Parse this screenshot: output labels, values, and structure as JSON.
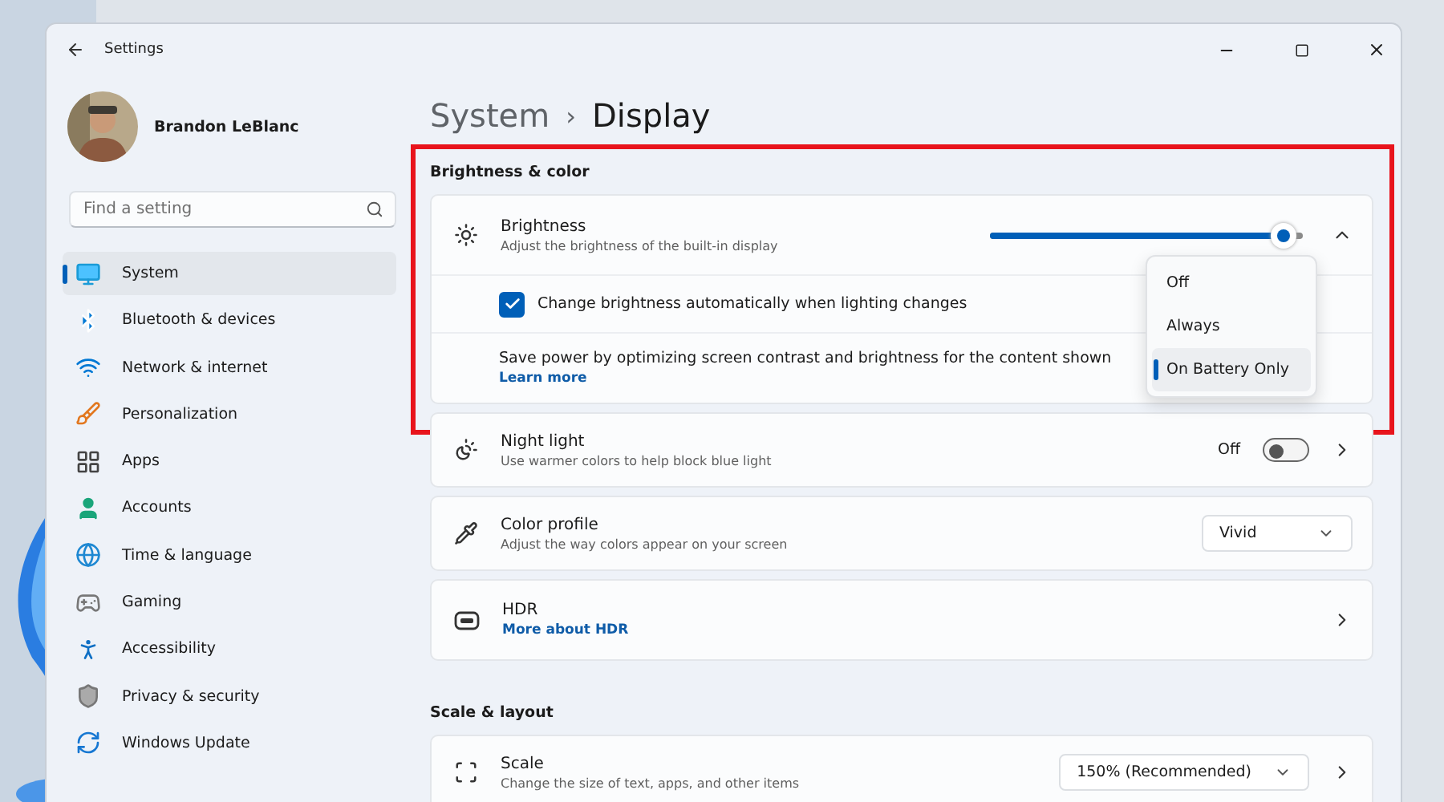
{
  "window": {
    "title": "Settings"
  },
  "user": {
    "name": "Brandon LeBlanc"
  },
  "search": {
    "placeholder": "Find a setting"
  },
  "nav": [
    {
      "label": "System",
      "selected": true
    },
    {
      "label": "Bluetooth & devices",
      "selected": false
    },
    {
      "label": "Network & internet",
      "selected": false
    },
    {
      "label": "Personalization",
      "selected": false
    },
    {
      "label": "Apps",
      "selected": false
    },
    {
      "label": "Accounts",
      "selected": false
    },
    {
      "label": "Time & language",
      "selected": false
    },
    {
      "label": "Gaming",
      "selected": false
    },
    {
      "label": "Accessibility",
      "selected": false
    },
    {
      "label": "Privacy & security",
      "selected": false
    },
    {
      "label": "Windows Update",
      "selected": false
    }
  ],
  "breadcrumb": {
    "parent": "System",
    "separator": "›",
    "current": "Display"
  },
  "sections": [
    {
      "title": "Brightness & color",
      "highlighted": true,
      "cards": [
        {
          "kind": "slider",
          "title": "Brightness",
          "subtitle": "Adjust the brightness of the built-in display",
          "level": 0.94,
          "expanded": true,
          "options": [
            {
              "kind": "checkbox",
              "label": "Change brightness automatically when lighting changes",
              "checked": true
            },
            {
              "kind": "text",
              "label": "Save power by optimizing screen contrast and brightness for the content shown",
              "link": "Learn more",
              "menu": [
                {
                  "label": "Off",
                  "selected": false
                },
                {
                  "label": "Always",
                  "selected": false
                },
                {
                  "label": "On Battery Only",
                  "selected": true
                }
              ]
            }
          ]
        }
      ]
    },
    {
      "cards": [
        {
          "kind": "toggle",
          "title": "Night light",
          "subtitle": "Use warmer colors to help block blue light",
          "state": "Off",
          "on": false,
          "chevron": true
        },
        {
          "kind": "select",
          "title": "Color profile",
          "subtitle": "Adjust the way colors appear on your screen",
          "value": "Vivid",
          "chevron": false
        },
        {
          "kind": "link",
          "title": "HDR",
          "link": "More about HDR",
          "chevron": true
        }
      ]
    },
    {
      "title": "Scale & layout",
      "cards": [
        {
          "kind": "select",
          "title": "Scale",
          "subtitle": "Change the size of text, apps, and other items",
          "value": "150% (Recommended)",
          "chevron": true
        }
      ]
    }
  ]
}
